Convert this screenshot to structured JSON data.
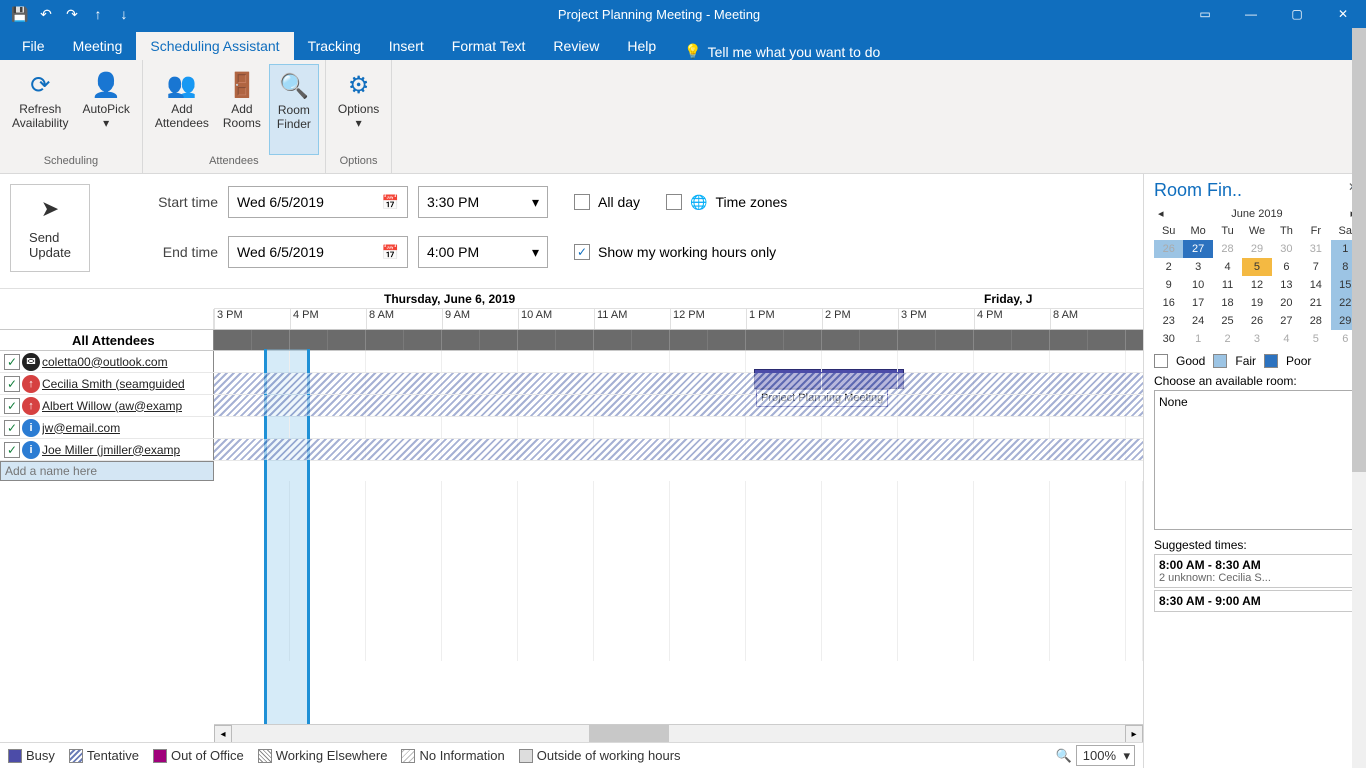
{
  "titlebar": {
    "title": "Project Planning Meeting  -  Meeting"
  },
  "tabs": {
    "file": "File",
    "meeting": "Meeting",
    "scheduling": "Scheduling Assistant",
    "tracking": "Tracking",
    "insert": "Insert",
    "format": "Format Text",
    "review": "Review",
    "help": "Help",
    "tellme": "Tell me what you want to do"
  },
  "ribbon": {
    "refresh": "Refresh\nAvailability",
    "autopick": "AutoPick",
    "addattendees": "Add\nAttendees",
    "addrooms": "Add\nRooms",
    "roomfinder": "Room\nFinder",
    "options": "Options",
    "group_scheduling": "Scheduling",
    "group_attendees": "Attendees",
    "group_options": "Options"
  },
  "send": {
    "line1": "Send",
    "line2": "Update"
  },
  "timelabels": {
    "start": "Start time",
    "end": "End time"
  },
  "dates": {
    "start": "Wed 6/5/2019",
    "end": "Wed 6/5/2019"
  },
  "times": {
    "start": "3:30 PM",
    "end": "4:00 PM"
  },
  "checks": {
    "allday": "All day",
    "timezones": "Time zones",
    "workhours": "Show my working hours only"
  },
  "dayheader": {
    "thu": "Thursday, June 6, 2019",
    "fri": "Friday, J"
  },
  "hours": [
    "3 PM",
    "4 PM",
    "8 AM",
    "9 AM",
    "10 AM",
    "11 AM",
    "12 PM",
    "1 PM",
    "2 PM",
    "3 PM",
    "4 PM",
    "8 AM"
  ],
  "attendees": {
    "header": "All Attendees",
    "a1": "coletta00@outlook.com",
    "a2": "Cecilia Smith (seamguided",
    "a3": "Albert Willow (aw@examp",
    "a4": "jw@email.com",
    "a5": "Joe Miller (jmiller@examp",
    "addname": "Add a name here"
  },
  "meeting_block": "Project Planning Meeting",
  "legend": {
    "busy": "Busy",
    "tentative": "Tentative",
    "oof": "Out of Office",
    "elsewhere": "Working Elsewhere",
    "noinfo": "No Information",
    "outside": "Outside of working hours"
  },
  "zoom": "100%",
  "roomfinder": {
    "title": "Room Fin..",
    "month": "June 2019",
    "days": [
      "Su",
      "Mo",
      "Tu",
      "We",
      "Th",
      "Fr",
      "Sa"
    ],
    "weeks": [
      [
        "26",
        "27",
        "28",
        "29",
        "30",
        "31",
        "1"
      ],
      [
        "2",
        "3",
        "4",
        "5",
        "6",
        "7",
        "8"
      ],
      [
        "9",
        "10",
        "11",
        "12",
        "13",
        "14",
        "15"
      ],
      [
        "16",
        "17",
        "18",
        "19",
        "20",
        "21",
        "22"
      ],
      [
        "23",
        "24",
        "25",
        "26",
        "27",
        "28",
        "29"
      ],
      [
        "30",
        "1",
        "2",
        "3",
        "4",
        "5",
        "6"
      ]
    ],
    "good": "Good",
    "fair": "Fair",
    "poor": "Poor",
    "choose": "Choose an available room:",
    "none": "None",
    "suggested_label": "Suggested times:",
    "slot1": "8:00 AM - 8:30 AM",
    "slot1_sub": "2 unknown: Cecilia S...",
    "slot2": "8:30 AM - 9:00 AM"
  }
}
